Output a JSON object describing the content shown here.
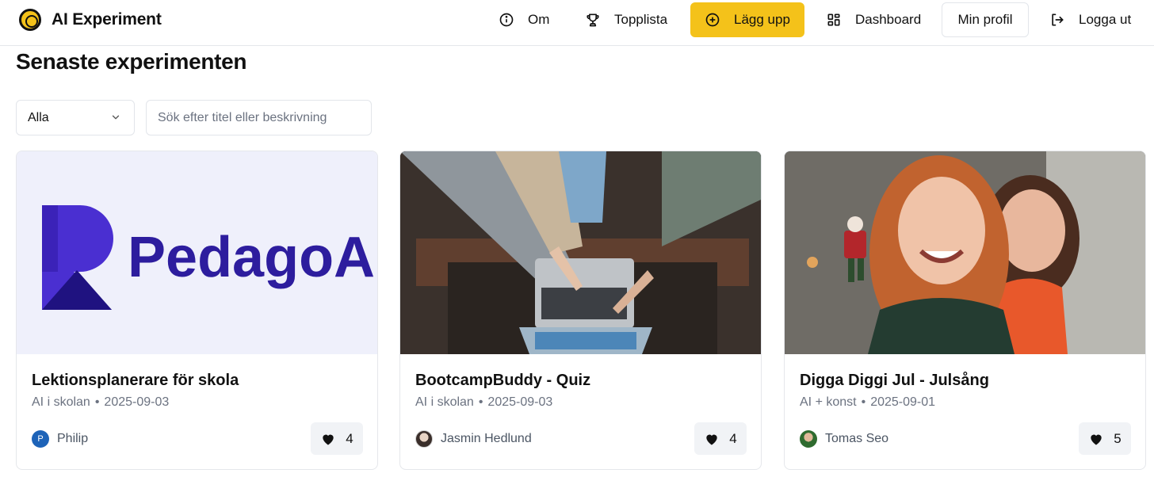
{
  "header": {
    "brand_title": "AI Experiment",
    "nav": {
      "about": "Om",
      "leaderboard": "Topplista",
      "upload": "Lägg upp",
      "dashboard": "Dashboard",
      "profile": "Min profil",
      "logout": "Logga ut"
    },
    "icons": {
      "brand": "ai-logo-icon",
      "about": "info-icon",
      "leaderboard": "trophy-icon",
      "upload": "plus-circle-icon",
      "dashboard": "grid-icon",
      "logout": "logout-icon"
    }
  },
  "page": {
    "title": "Senaste experimenten"
  },
  "filters": {
    "category_selected": "Alla",
    "search_placeholder": "Sök efter titel eller beskrivning",
    "search_value": ""
  },
  "cards": [
    {
      "title": "Lektionsplanerare för skola",
      "category": "AI i skolan",
      "date": "2025-09-03",
      "author": "Philip",
      "avatar_initial": "P",
      "likes": "4",
      "thumbnail_logo_text": "PedagoAI"
    },
    {
      "title": "BootcampBuddy - Quiz",
      "category": "AI i skolan",
      "date": "2025-09-03",
      "author": "Jasmin Hedlund",
      "likes": "4"
    },
    {
      "title": "Digga Diggi Jul - Julsång",
      "category": "AI + konst",
      "date": "2025-09-01",
      "author": "Tomas Seo",
      "likes": "5"
    }
  ],
  "colors": {
    "accent": "#f4c21a",
    "logo_purple": "#2d1d9e",
    "card_border": "#e5e7eb",
    "muted_text": "#6b7280",
    "like_bg": "#f1f3f6"
  }
}
